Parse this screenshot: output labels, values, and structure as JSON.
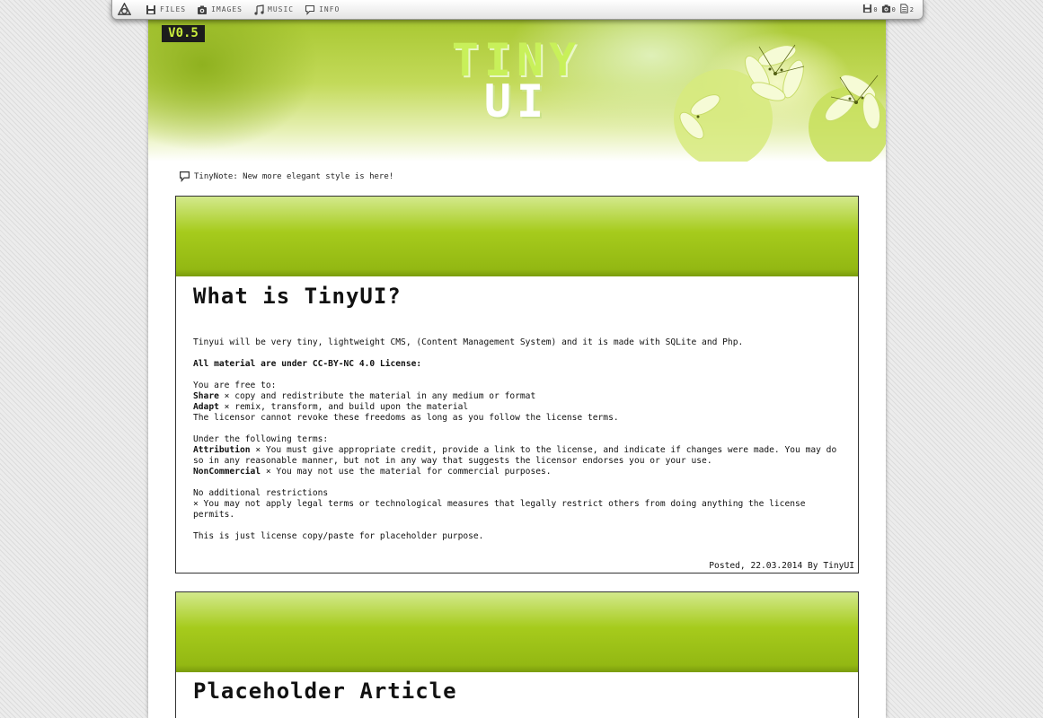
{
  "topbar": {
    "nav": [
      {
        "label": "Files",
        "icon": "floppy-icon"
      },
      {
        "label": "Images",
        "icon": "camera-icon"
      },
      {
        "label": "Music",
        "icon": "music-icon"
      },
      {
        "label": "Info",
        "icon": "speech-bubble-icon"
      }
    ],
    "stats": [
      {
        "icon": "floppy-icon",
        "value": "0"
      },
      {
        "icon": "camera-icon",
        "value": "0"
      },
      {
        "icon": "document-icon",
        "value": "2"
      }
    ]
  },
  "header": {
    "version": "V0.5",
    "brand_line1": "TINY",
    "brand_line2": "UI"
  },
  "note": {
    "text": "TinyNote: New more elegant style is here!"
  },
  "articles": [
    {
      "title": "What is TinyUI?",
      "intro": "Tinyui will be very tiny, lightweight CMS, (Content Management System) and it is made with SQLite and Php.",
      "license_heading": "All material are under CC-BY-NC 4.0 License:",
      "free_to": "You are free to:",
      "share_label": "Share",
      "share_text": "× copy and redistribute the material in any medium or format",
      "adapt_label": "Adapt",
      "adapt_text": "× remix, transform, and build upon the material",
      "revoke_text": "The licensor cannot revoke these freedoms as long as you follow the license terms.",
      "terms_heading": "Under the following terms:",
      "attribution_label": "Attribution",
      "attribution_text": "× You must give appropriate credit, provide a link to the license, and indicate if changes were made. You may do so in any reasonable manner, but not in any way that suggests the licensor endorses you or your use.",
      "noncommercial_label": "NonCommercial",
      "noncommercial_text": "× You may not use the material for commercial purposes.",
      "restrictions_heading": "No additional restrictions",
      "restrictions_text": "× You may not apply legal terms or technological measures that legally restrict others from doing anything the license permits.",
      "placeholder_note": "This is just license copy/paste for placeholder purpose.",
      "posted": "Posted, 22.03.2014 By TinyUI"
    },
    {
      "title": "Placeholder Article"
    }
  ],
  "colors": {
    "accent_green": "#a6cb1c",
    "version_text": "#c9ec3c"
  }
}
